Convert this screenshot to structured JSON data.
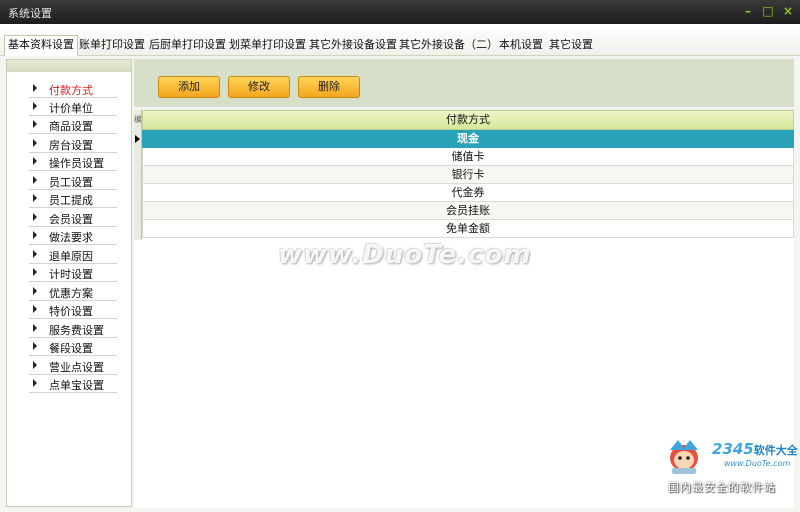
{
  "window": {
    "title": "系统设置",
    "controls": {
      "minimize": "–",
      "maximize": "□",
      "close": "×"
    }
  },
  "tabs": [
    {
      "label": "基本资料设置",
      "active": true
    },
    {
      "label": "账单打印设置"
    },
    {
      "label": "后厨单打印设置"
    },
    {
      "label": "划菜单打印设置"
    },
    {
      "label": "其它外接设备设置"
    },
    {
      "label": "其它外接设备（二）"
    },
    {
      "label": "本机设置"
    },
    {
      "label": "其它设置"
    }
  ],
  "sidebar": {
    "items": [
      {
        "label": "付款方式",
        "active": true
      },
      {
        "label": "计价单位"
      },
      {
        "label": "商品设置"
      },
      {
        "label": "房台设置"
      },
      {
        "label": "操作员设置"
      },
      {
        "label": "员工设置"
      },
      {
        "label": "员工提成"
      },
      {
        "label": "会员设置"
      },
      {
        "label": "做法要求"
      },
      {
        "label": "退单原因"
      },
      {
        "label": "计时设置"
      },
      {
        "label": "优惠方案"
      },
      {
        "label": "特价设置"
      },
      {
        "label": "服务费设置"
      },
      {
        "label": "餐段设置"
      },
      {
        "label": "营业点设置"
      },
      {
        "label": "点单宝设置"
      }
    ]
  },
  "toolbar": {
    "add_label": "添加",
    "edit_label": "修改",
    "delete_label": "删除"
  },
  "grid": {
    "corner": "编",
    "column_header": "付款方式",
    "rows": [
      "现金",
      "储值卡",
      "银行卡",
      "代金券",
      "会员挂账",
      "免单金额"
    ],
    "selected_index": 0
  },
  "watermarks": {
    "center": "www.DuoTe.com",
    "brand": "2345",
    "brand_cn": "软件大全",
    "url": "www.DuoTe.com",
    "slogan": "国内最安全的软件站"
  },
  "colors": {
    "selected_row": "#2aa3b8",
    "button": "#f4a51c",
    "active_nav": "#d42020",
    "header": "#d6e89a"
  }
}
